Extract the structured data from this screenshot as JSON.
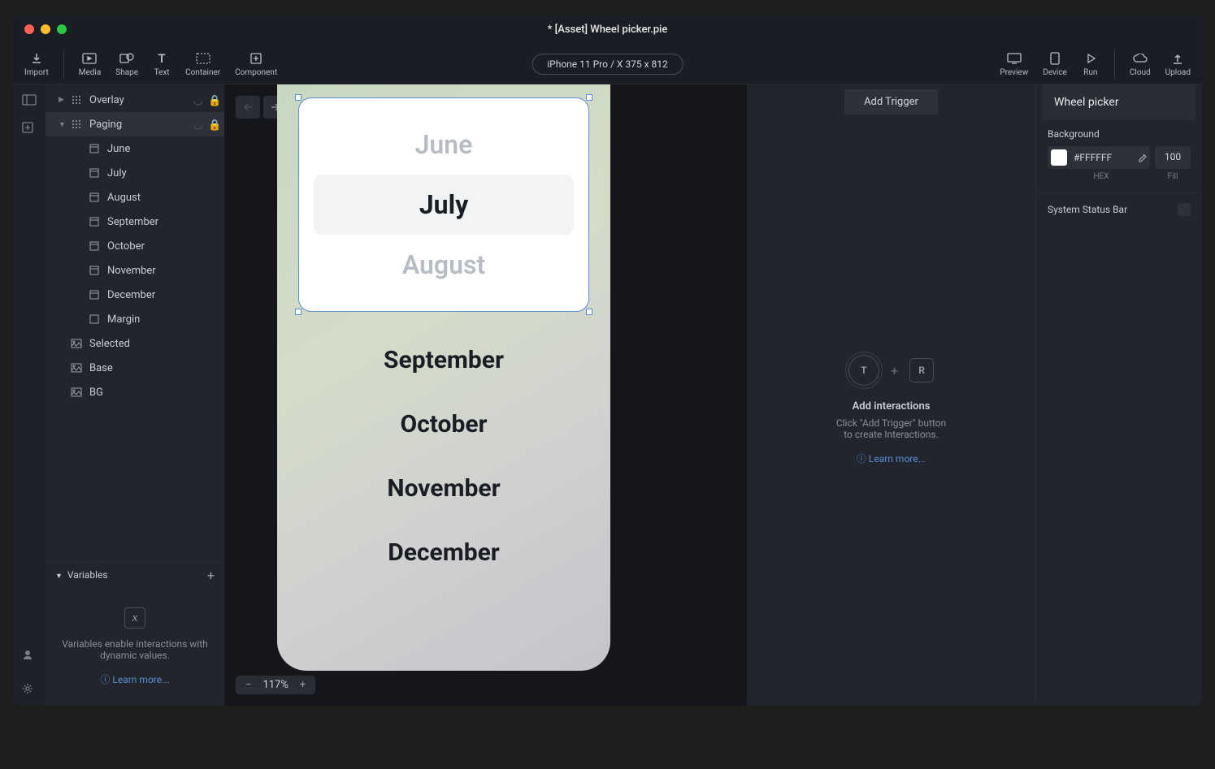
{
  "window": {
    "title": "* [Asset] Wheel picker.pie"
  },
  "toolbar": {
    "import": "Import",
    "media": "Media",
    "shape": "Shape",
    "text": "Text",
    "container": "Container",
    "component": "Component",
    "device_pill": "iPhone 11 Pro / X  375 x 812",
    "preview": "Preview",
    "device": "Device",
    "run": "Run",
    "cloud": "Cloud",
    "upload": "Upload"
  },
  "layers": {
    "overlay": "Overlay",
    "paging": "Paging",
    "months": [
      "June",
      "July",
      "August",
      "September",
      "October",
      "November",
      "December"
    ],
    "margin": "Margin",
    "selected": "Selected",
    "base": "Base",
    "bg": "BG"
  },
  "variables": {
    "header": "Variables",
    "desc": "Variables enable interactions with dynamic values.",
    "learn": "Learn more..."
  },
  "canvas": {
    "months_card": [
      "June",
      "July",
      "August"
    ],
    "months_below": [
      "September",
      "October",
      "November",
      "December"
    ],
    "zoom": "117%"
  },
  "interactions": {
    "add_trigger": "Add Trigger",
    "empty_title": "Add interactions",
    "empty_desc1": "Click \"Add Trigger\" button",
    "empty_desc2": "to create Interactions.",
    "learn": "Learn more..."
  },
  "inspector": {
    "title": "Wheel picker",
    "background_label": "Background",
    "color_hex": "#FFFFFF",
    "fill": "100",
    "hex_label": "HEX",
    "fill_label": "Fill",
    "status_bar": "System Status Bar"
  }
}
